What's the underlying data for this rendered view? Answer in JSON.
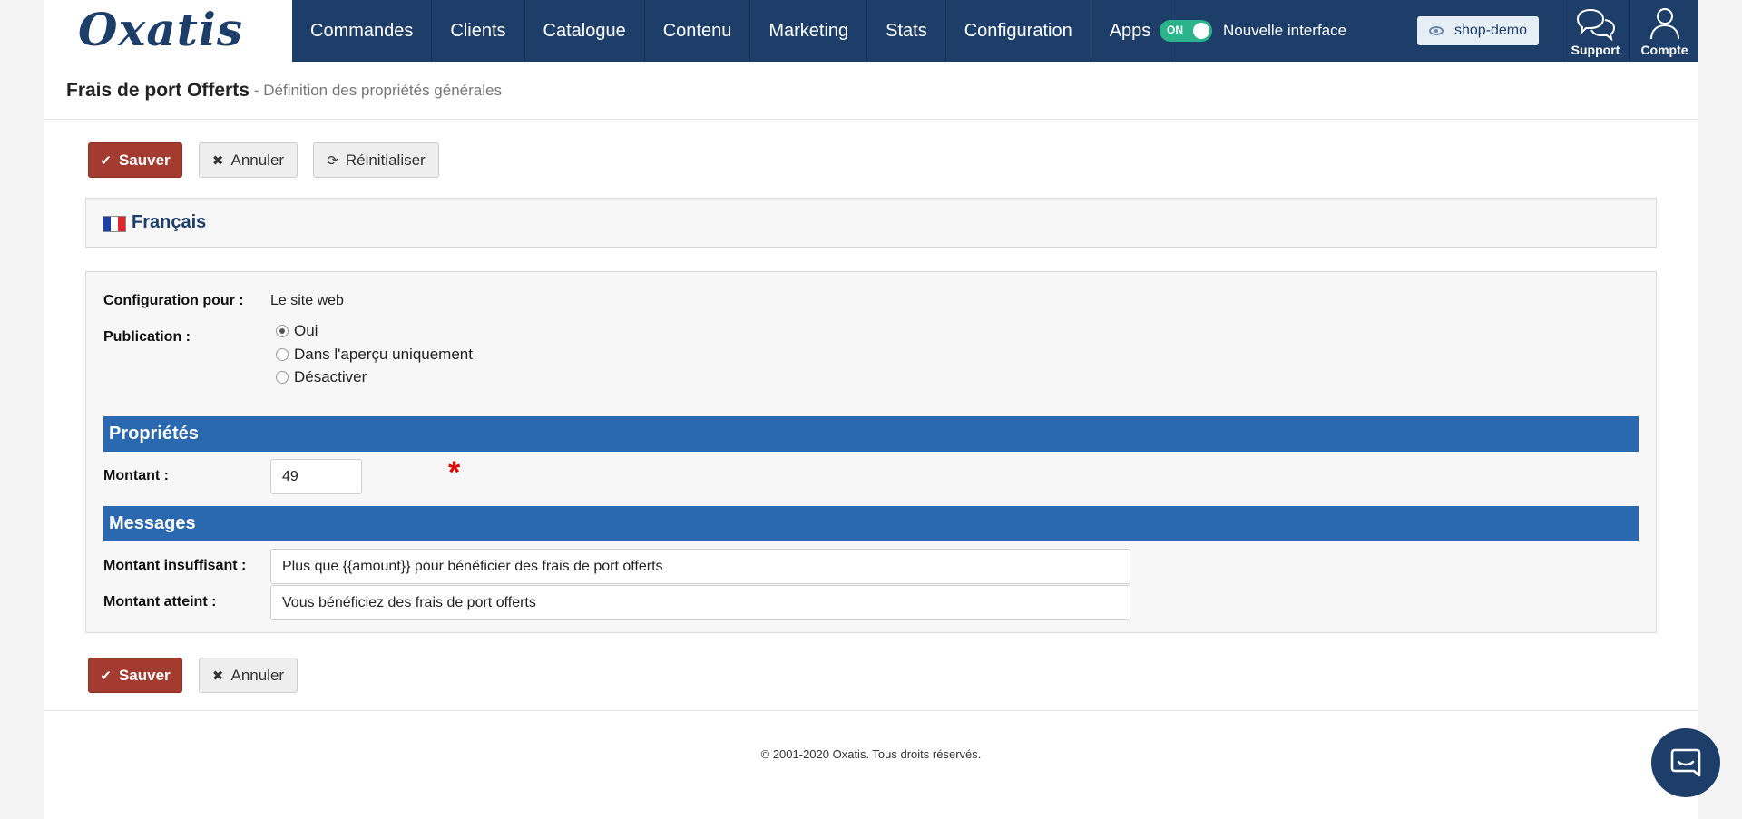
{
  "brand": {
    "logo": "Oxatis"
  },
  "nav": {
    "items": [
      "Commandes",
      "Clients",
      "Catalogue",
      "Contenu",
      "Marketing",
      "Stats",
      "Configuration",
      "Apps"
    ],
    "toggle_state": "ON",
    "toggle_label": "Nouvelle interface",
    "shop_label": "shop-demo",
    "support_label": "Support",
    "account_label": "Compte"
  },
  "header": {
    "title": "Frais de port Offerts",
    "subtitle": "- Définition des propriétés générales"
  },
  "toolbar": {
    "save_label": "Sauver",
    "cancel_label": "Annuler",
    "reset_label": "Réinitialiser"
  },
  "language": {
    "label": "Français"
  },
  "form": {
    "config_label": "Configuration pour :",
    "config_value": "Le site web",
    "publication_label": "Publication :",
    "publication_options": [
      "Oui",
      "Dans l'aperçu uniquement",
      "Désactiver"
    ],
    "publication_selected": "Oui",
    "properties_title": "Propriétés",
    "amount_label": "Montant :",
    "amount_value": "49",
    "required_mark": "*",
    "messages_title": "Messages",
    "insufficient_label": "Montant insuffisant :",
    "insufficient_value": "Plus que {{amount}} pour bénéficier des frais de port offerts",
    "reached_label": "Montant atteint :",
    "reached_value": "Vous bénéficiez des frais de port offerts"
  },
  "footer": {
    "copyright": "© 2001-2020 Oxatis. Tous droits réservés."
  },
  "colors": {
    "nav_bg": "#1e3e6a",
    "section_bar": "#2a69b0",
    "save_button": "#a33b30",
    "toggle_on": "#2bb38b",
    "required": "#e00000"
  },
  "icons": {
    "save": "check-icon",
    "cancel": "x-icon",
    "reset": "refresh-icon",
    "shop": "eye-icon",
    "support": "chat-bubbles-icon",
    "account": "user-icon",
    "chat": "chat-icon",
    "language": "french-flag-icon"
  }
}
